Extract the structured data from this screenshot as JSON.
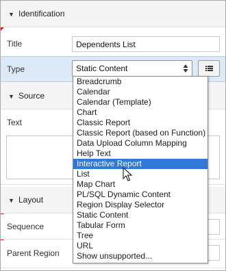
{
  "identification": {
    "header": "Identification",
    "title_label": "Title",
    "title_value": "Dependents List",
    "type_label": "Type",
    "type_value": "Static Content"
  },
  "source": {
    "header": "Source",
    "text_label": "Text"
  },
  "layout": {
    "header": "Layout",
    "sequence_label": "Sequence",
    "parent_region_label": "Parent Region"
  },
  "type_options": [
    "Breadcrumb",
    "Calendar",
    "Calendar (Template)",
    "Chart",
    "Classic Report",
    "Classic Report (based on Function)",
    "Data Upload Column Mapping",
    "Help Text",
    "Interactive Report",
    "List",
    "Map Chart",
    "PL/SQL Dynamic Content",
    "Region Display Selector",
    "Static Content",
    "Tabular Form",
    "Tree",
    "URL",
    "Show unsupported..."
  ],
  "highlighted_option": "Interactive Report",
  "icons": [
    "triangle-down-icon",
    "updown-arrows-icon",
    "list-icon",
    "mouse-pointer-icon"
  ],
  "colors": {
    "highlight": "#3079d8",
    "selected_row": "#dce9f7",
    "required_marker": "#c81e1e"
  }
}
